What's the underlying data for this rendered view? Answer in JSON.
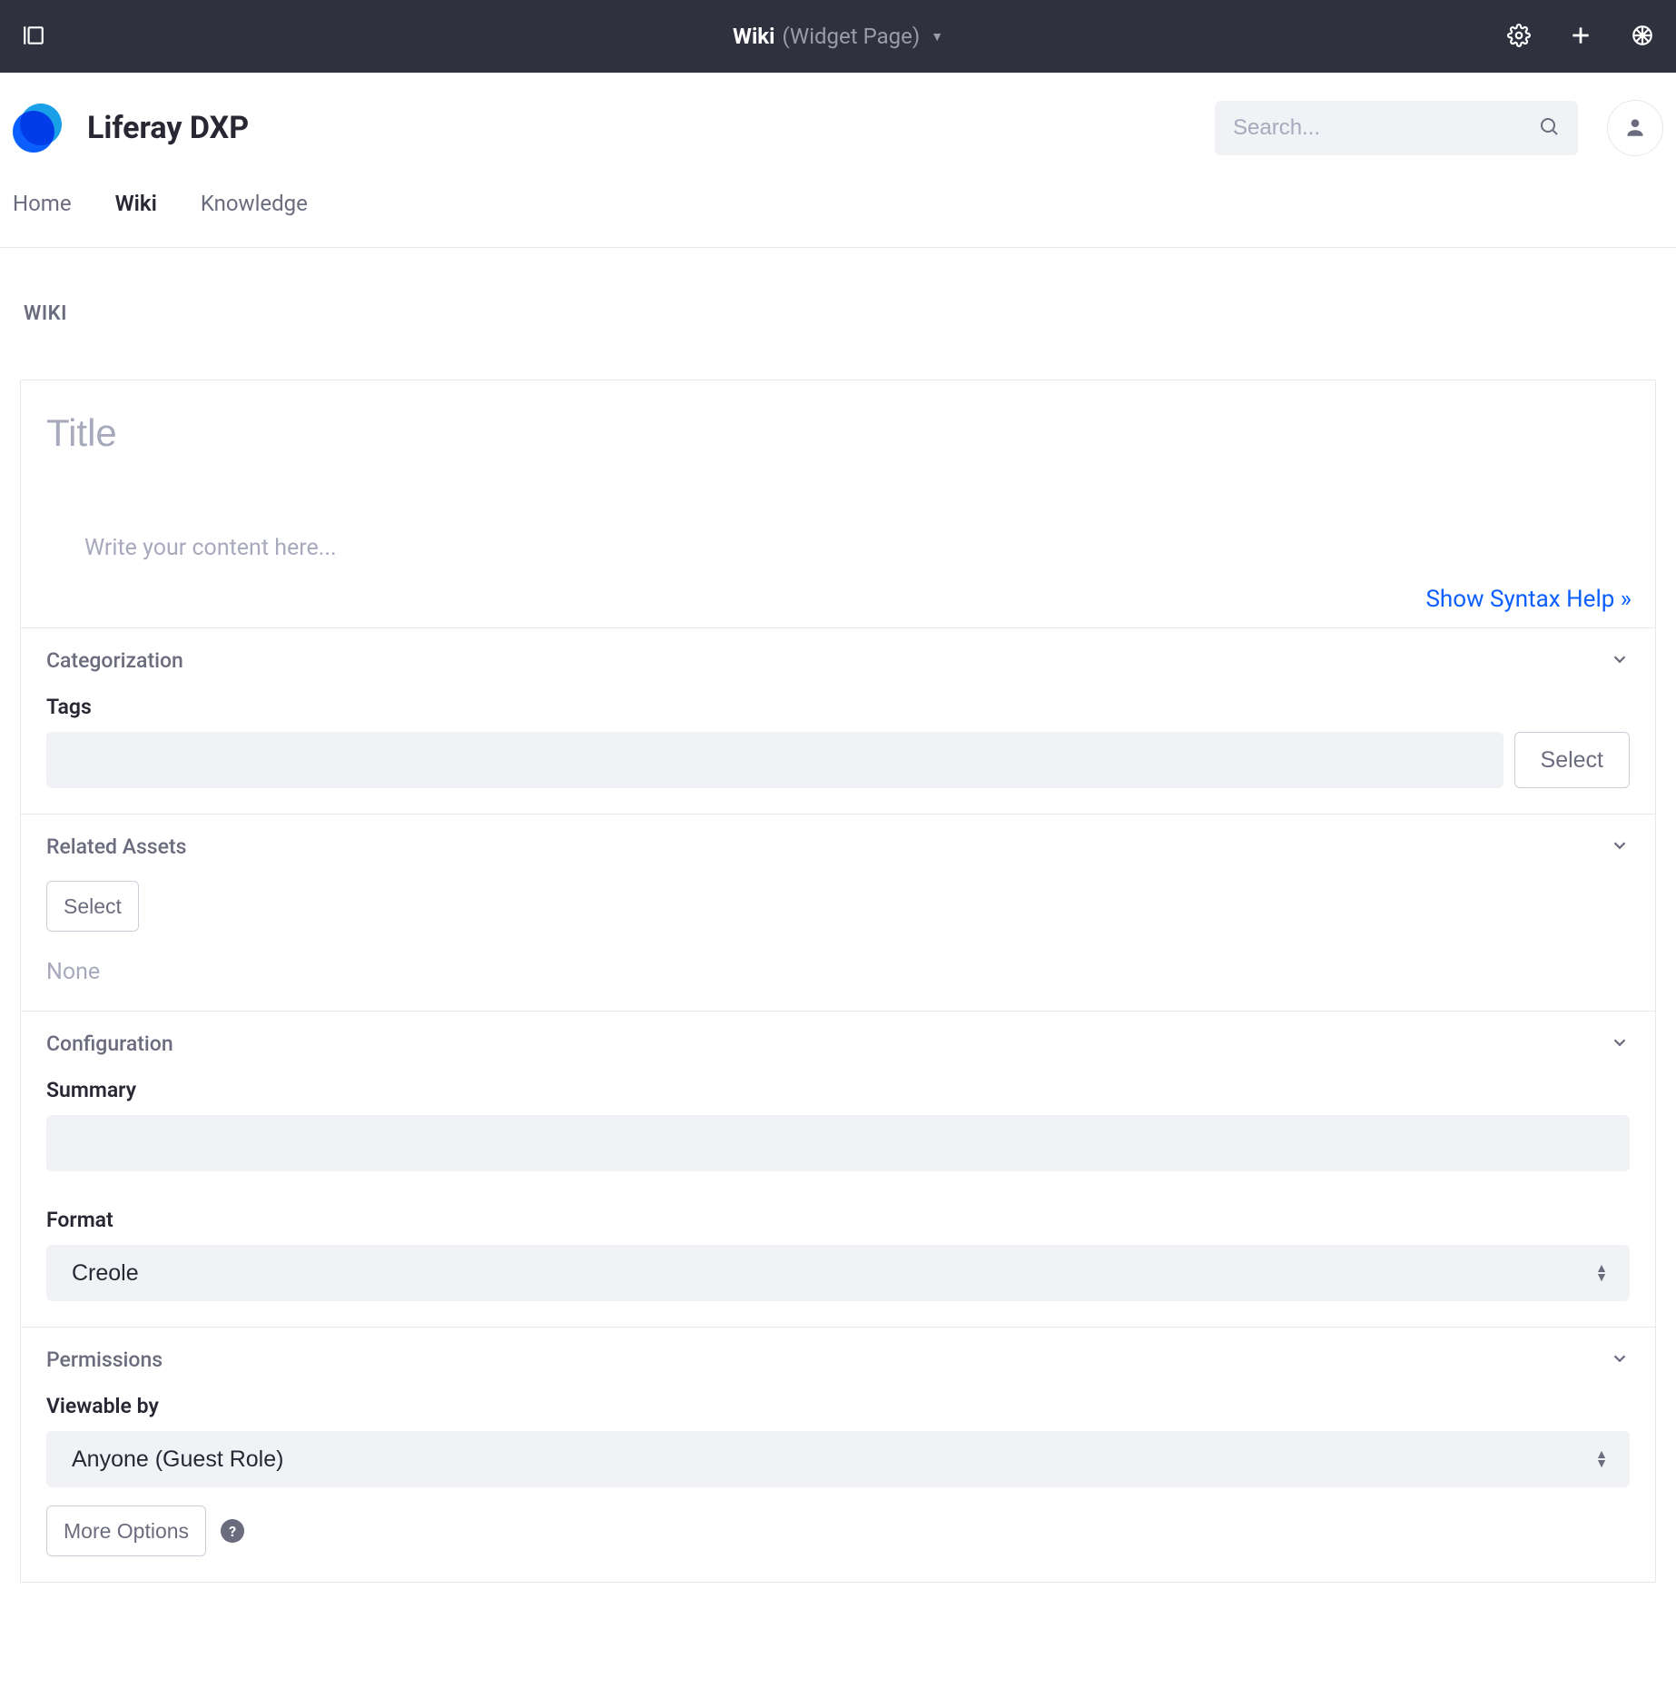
{
  "topbar": {
    "title": "Wiki",
    "subtitle": "(Widget Page)"
  },
  "site": {
    "name": "Liferay DXP",
    "search_placeholder": "Search..."
  },
  "nav": {
    "items": [
      {
        "label": "Home",
        "active": false
      },
      {
        "label": "Wiki",
        "active": true
      },
      {
        "label": "Knowledge",
        "active": false
      }
    ]
  },
  "page": {
    "label": "WIKI",
    "title_placeholder": "Title",
    "content_placeholder": "Write your content here...",
    "syntax_help": "Show Syntax Help »"
  },
  "panels": {
    "categorization": {
      "title": "Categorization",
      "tags_label": "Tags",
      "select_btn": "Select"
    },
    "related": {
      "title": "Related Assets",
      "select_btn": "Select",
      "empty": "None"
    },
    "configuration": {
      "title": "Configuration",
      "summary_label": "Summary",
      "format_label": "Format",
      "format_value": "Creole"
    },
    "permissions": {
      "title": "Permissions",
      "viewable_label": "Viewable by",
      "viewable_value": "Anyone (Guest Role)",
      "more_options": "More Options",
      "help": "?"
    }
  }
}
